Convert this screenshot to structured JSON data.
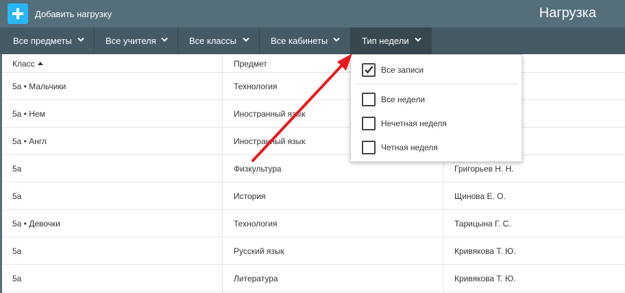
{
  "header": {
    "add_button_label": "Добавить нагрузку",
    "page_title": "Нагрузка"
  },
  "filters": [
    {
      "label": "Все предметы"
    },
    {
      "label": "Все учителя"
    },
    {
      "label": "Все классы"
    },
    {
      "label": "Все кабинеты"
    },
    {
      "label": "Тип недели"
    }
  ],
  "table": {
    "columns": [
      "Класс",
      "Предмет",
      ""
    ],
    "rows": [
      [
        "5а • Мальчики",
        "Технология",
        ""
      ],
      [
        "5а • Нем",
        "Иностранный язык",
        ""
      ],
      [
        "5а • Англ",
        "Иностранный язык",
        ""
      ],
      [
        "5а",
        "Физкультура",
        "Григорьев Н. Н."
      ],
      [
        "5а",
        "История",
        "Щинова Е. О."
      ],
      [
        "5а • Девочки",
        "Технология",
        "Тарицына Г. С."
      ],
      [
        "5а",
        "Русский язык",
        "Кривякова Т. Ю."
      ],
      [
        "5а",
        "Литература",
        "Кривякова Т. Ю."
      ]
    ]
  },
  "week_dropdown": {
    "options": [
      {
        "label": "Все записи",
        "checked": true
      },
      {
        "label": "Все недели",
        "checked": false
      },
      {
        "label": "Нечетная неделя",
        "checked": false
      },
      {
        "label": "Четная неделя",
        "checked": false
      }
    ]
  },
  "colors": {
    "topbar": "#546e7a",
    "filterbar": "#455a64",
    "accent": "#29b6f6",
    "annotation_arrow": "#e8191c"
  }
}
